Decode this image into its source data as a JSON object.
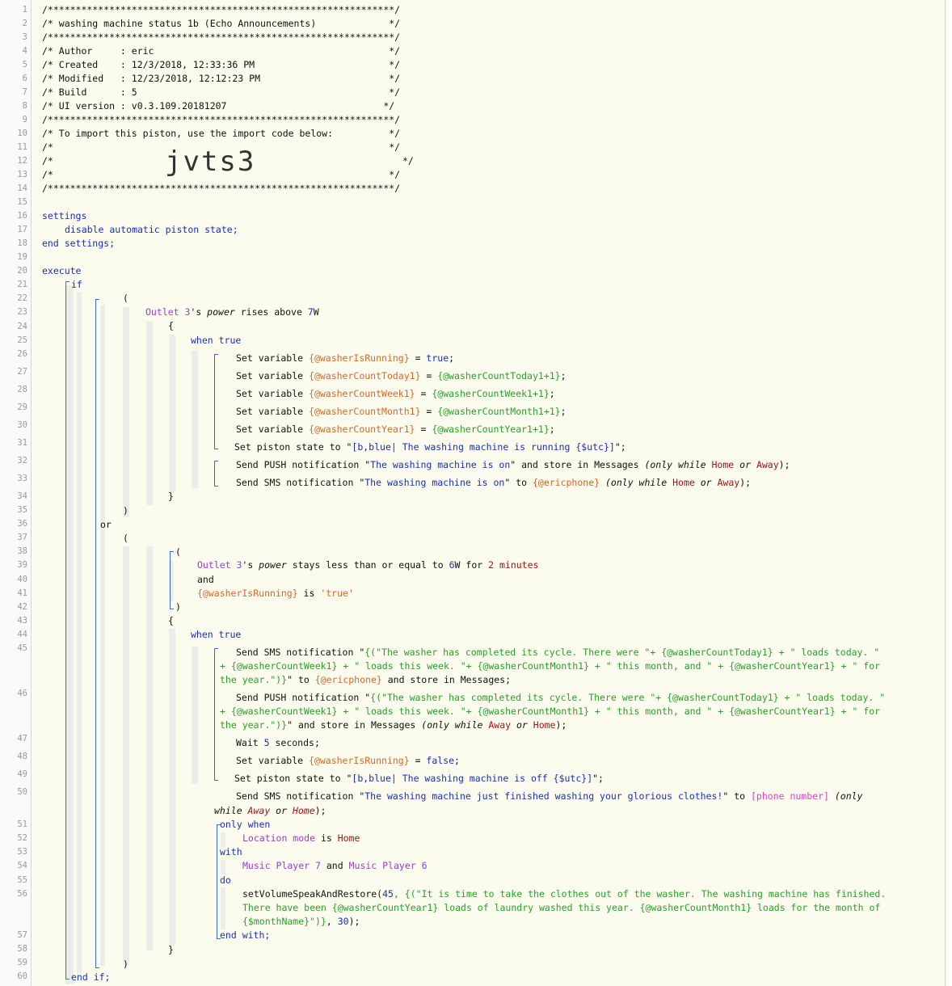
{
  "line_numbers": [
    "1",
    "2",
    "3",
    "4",
    "5",
    "6",
    "7",
    "8",
    "9",
    "10",
    "11",
    "12",
    "13",
    "14",
    "15",
    "16",
    "17",
    "18",
    "19",
    "20",
    "21",
    "22",
    "23",
    "24",
    "25",
    "26",
    "27",
    "28",
    "29",
    "30",
    "31",
    "32",
    "33",
    "34",
    "35",
    "36",
    "37",
    "38",
    "39",
    "40",
    "41",
    "42",
    "43",
    "44",
    "45",
    "46",
    "47",
    "48",
    "49",
    "50",
    "51",
    "52",
    "53",
    "54",
    "55",
    "56",
    "57",
    "58",
    "59",
    "60"
  ],
  "header": {
    "border": "/**************************************************************/",
    "title": "/* washing machine status 1b (Echo Announcements)             */",
    "author": "/* Author     : eric                                          */",
    "created": "/* Created    : 12/3/2018, 12:33:36 PM                        */",
    "modified": "/* Modified   : 12/23/2018, 12:12:23 PM                       */",
    "build": "/* Build      : 5                                             */",
    "ui_version": "/* UI version : v0.3.109.20181207                            */",
    "import_line": "/* To import this piston, use the import code below:          */",
    "blank_line": "/*                                                            */",
    "code_prefix": "/*",
    "code_suffix": "*/",
    "import_code": "jvts3"
  },
  "kw": {
    "settings": "settings",
    "disable": "disable automatic piston state;",
    "end_settings": "end settings;",
    "execute": "execute",
    "if": "if",
    "open_paren": "(",
    "close_paren": ")",
    "or": "or",
    "and": "and",
    "open_brace": "{",
    "close_brace": "}",
    "when_true": "when true",
    "only_when": "only when",
    "with": "with",
    "do": "do",
    "end_with": "end with;",
    "end_if": "end if;",
    "set_variable": "Set variable ",
    "eq": " = ",
    "semi": ";",
    "set_piston_state": "Set piston state to \"",
    "state_close": "\";",
    "send_push": "Send PUSH notification \"",
    "send_sms": "Send SMS notification \"",
    "store_msgs": "\" and store in Messages ",
    "to": "\" to ",
    "only_while": "(only while ",
    "or_word": " or ",
    "close_only": ");",
    "wait": "Wait ",
    "seconds": " seconds;"
  },
  "conditions": {
    "device_outlet": "Outlet 3",
    "possessive": "'s ",
    "attr_power": "power",
    "rises_above": " rises above ",
    "rise_value": "7",
    "unit_w": "W",
    "stays_le": " stays less than or equal to ",
    "stay_value": "6",
    "for_word": " for ",
    "duration_val": "2",
    "duration_unit": "minutes",
    "var_running": "{@washerIsRunning}",
    "is_word": " is ",
    "true_str": "'true'",
    "location_mode": "Location mode",
    "home": "Home",
    "away": "Away",
    "music7": "Music Player 7",
    "music6": "Music Player 6"
  },
  "vars": {
    "running": "{@washerIsRunning}",
    "today": "{@washerCountToday1}",
    "week": "{@washerCountWeek1}",
    "month": "{@washerCountMonth1}",
    "year": "{@washerCountYear1}",
    "today_inc": "{@washerCountToday1+1}",
    "week_inc": "{@washerCountWeek1+1}",
    "month_inc": "{@washerCountMonth1+1}",
    "year_inc": "{@washerCountYear1+1}",
    "true_v": "true",
    "false_v": "false",
    "phone_var": "{@ericphone}",
    "phone_number": "[phone number]"
  },
  "strings": {
    "state_prefix": "[b,blue| ",
    "running_state": "The washing machine is running {$utc}]",
    "off_state": "The washing machine is off {$utc}]",
    "washing_on": "The washing machine is on",
    "finished": "The washing machine just finished washing your glorious clothes!",
    "cycle_l1_a": "{(\"The washer has completed its cycle. There were \"+ ",
    "cycle_l1_b": " + \" loads today. \"",
    "cycle_l2_a": "+ ",
    "cycle_l2_b": " + \" loads this week. \"+ ",
    "cycle_l2_c": " + \" this month, and \" + ",
    "cycle_l2_d": " + \" for",
    "cycle_l3": "the year.\")}",
    "wait_value": "5",
    "speak_fn": "setVolumeSpeakAndRestore(",
    "speak_vol": "45",
    "speak_l1": ", {(\"It is time to take the clothes out of the washer. The washing machine has finished.",
    "speak_l2_a": "There have been ",
    "speak_l2_b": " loads of laundry washed this year. ",
    "speak_l2_c": " loads for the month of",
    "speak_l3_a": "{$monthName}\")}",
    "speak_l3_b": ", ",
    "speak_delay": "30",
    "speak_l3_c": ");"
  }
}
